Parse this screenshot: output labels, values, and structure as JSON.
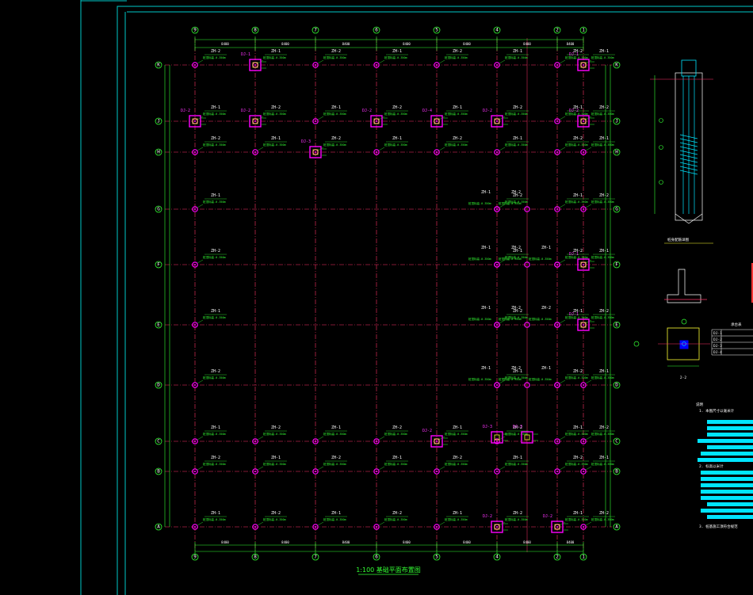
{
  "drawing": {
    "title": "1:100 基础平面布置图",
    "colors": {
      "background": "#000000",
      "frame": "#00c8c8",
      "axis_line": "#ff3366",
      "bubble": "#33ff33",
      "dimension": "#33ff33",
      "pile_ring": "#ff00ff",
      "pile_tag": "#ffffff",
      "pile_note": "#33ff33",
      "cap": "#ff00ff",
      "notes_bar": "#00e5ff"
    },
    "columns": [
      "9",
      "8",
      "7",
      "6",
      "5",
      "4",
      "2",
      "1"
    ],
    "rows": [
      "A",
      "B",
      "C",
      "D",
      "E",
      "F",
      "G",
      "H",
      "J",
      "K"
    ],
    "pile_types": [
      "ZH-1",
      "ZH-2",
      "ZH-3"
    ],
    "cap_types": [
      "DJ-1",
      "DJ-2",
      "DJ-3",
      "DJ-4"
    ],
    "pile_note_text": "桩顶标高-0.350m",
    "dimension_text": "8400"
  },
  "detail": {
    "pile_section_label": "桩身配筋详图",
    "cap_section_label": "承台详图",
    "cap_plan_label": "2-2",
    "table_title": "承台表"
  },
  "notes": {
    "heading": "说明",
    "items": [
      "1. 本图尺寸以毫米计",
      "2. 标高以米计",
      "3. 桩基施工须符合规范"
    ]
  }
}
